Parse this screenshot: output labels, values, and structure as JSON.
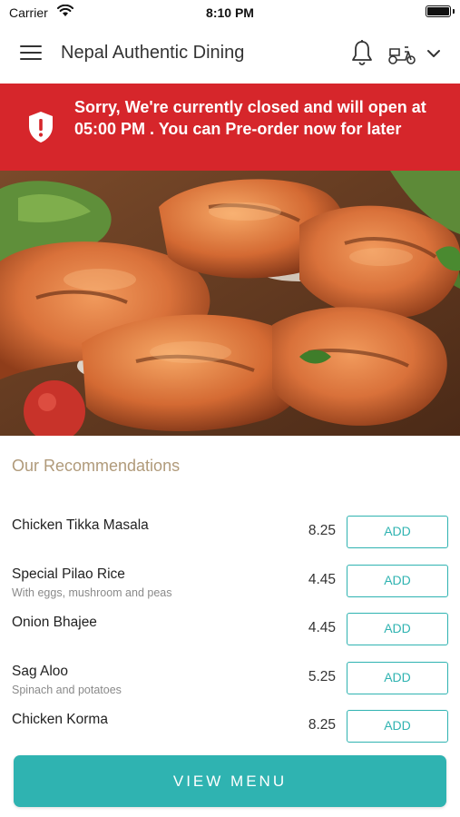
{
  "status_bar": {
    "carrier": "Carrier",
    "time": "8:10 PM",
    "icons": [
      "wifi-icon",
      "battery-icon"
    ]
  },
  "nav": {
    "title": "Nepal Authentic Dining",
    "icons": [
      "menu-icon",
      "bell-icon",
      "scooter-icon",
      "chevron-down-icon"
    ]
  },
  "banner": {
    "message": "Sorry, We're currently closed and will open at 05:00 PM . You can Pre-order now for later",
    "icon": "shield-alert-icon",
    "background_color": "#d6262b"
  },
  "hero": {
    "icon": "food-photo"
  },
  "recommendations": {
    "heading": "Our Recommendations",
    "items": [
      {
        "name": "Chicken Tikka Masala",
        "description": "",
        "price": "8.25",
        "button_label": "ADD"
      },
      {
        "name": "Special Pilao Rice",
        "description": "With eggs, mushroom and peas",
        "price": "4.45",
        "button_label": "ADD"
      },
      {
        "name": "Onion Bhajee",
        "description": "",
        "price": "4.45",
        "button_label": "ADD"
      },
      {
        "name": "Sag Aloo",
        "description": "Spinach and potatoes",
        "price": "5.25",
        "button_label": "ADD"
      },
      {
        "name": "Chicken Korma",
        "description": "",
        "price": "8.25",
        "button_label": "ADD"
      }
    ]
  },
  "footer": {
    "view_menu_label": "VIEW MENU",
    "accent_color": "#2fb3b1"
  }
}
